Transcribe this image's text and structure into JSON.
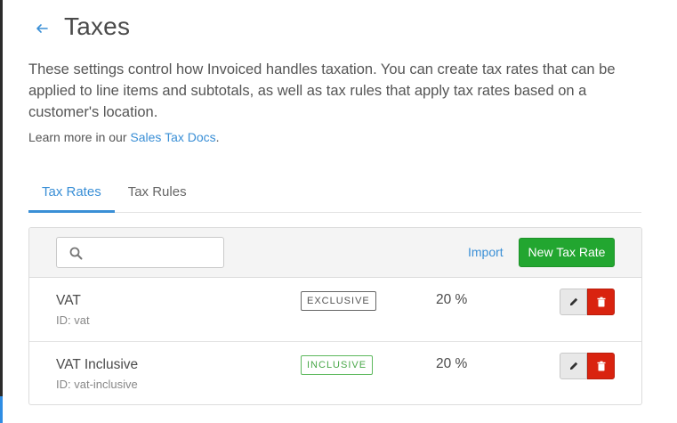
{
  "header": {
    "title": "Taxes",
    "back_icon": "back-arrow-icon"
  },
  "description": "These settings control how Invoiced handles taxation. You can create tax rates that can be applied to line items and subtotals, as well as tax rules that apply tax rates based on a customer's location.",
  "learn_more": {
    "prefix": "Learn more in our",
    "link_label": "Sales Tax Docs",
    "suffix": "."
  },
  "tabs": [
    {
      "label": "Tax Rates",
      "active": true
    },
    {
      "label": "Tax Rules",
      "active": false
    }
  ],
  "toolbar": {
    "search_value": "",
    "search_placeholder": "",
    "import_label": "Import",
    "new_label": "New Tax Rate"
  },
  "rows": [
    {
      "name": "VAT",
      "id_text": "ID: vat",
      "badge": "EXCLUSIVE",
      "rate": "20 %"
    },
    {
      "name": "VAT Inclusive",
      "id_text": "ID: vat-inclusive",
      "badge": "INCLUSIVE",
      "rate": "20 %"
    }
  ],
  "colors": {
    "accent": "#3a8fd6",
    "primary_button": "#22a630",
    "danger_button": "#d9230f",
    "inclusive_badge": "#5cb85c"
  }
}
